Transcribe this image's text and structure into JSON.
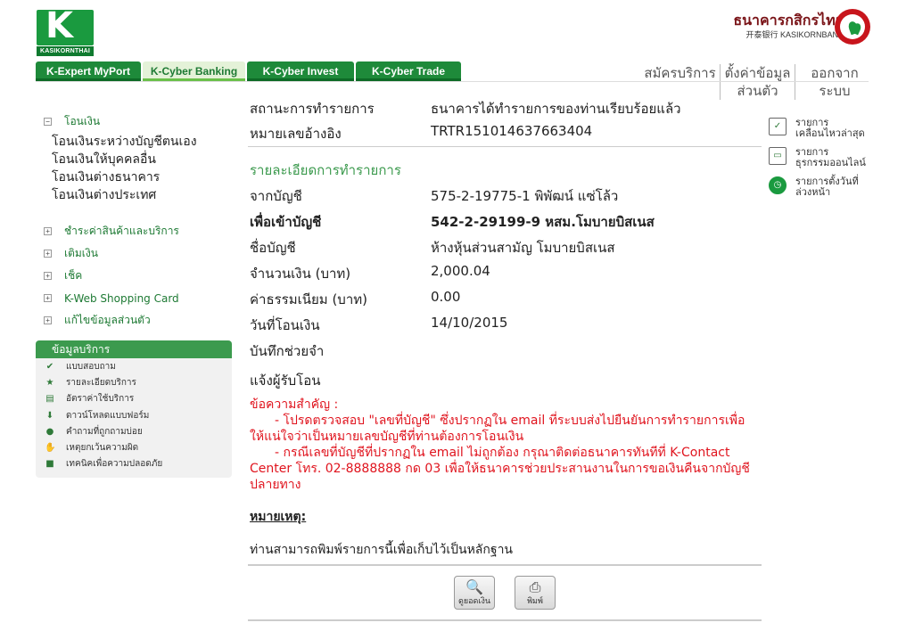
{
  "brand": {
    "logo_word": "KASIKORNTHAI",
    "logo_letter": "K",
    "bank_name_th": "ธนาคารกสิกรไทย",
    "bank_name_en": "开泰银行 KASIKORNBANK"
  },
  "main_tabs": [
    {
      "label": "K-Expert MyPort",
      "active": false
    },
    {
      "label": "K-Cyber Banking",
      "active": true
    },
    {
      "label": "K-Cyber Invest",
      "active": false
    },
    {
      "label": "K-Cyber Trade",
      "active": false
    }
  ],
  "top_links": {
    "register": "สมัครบริการ",
    "settings_line1": "ตั้งค่าข้อมูล",
    "settings_line2": "ส่วนตัว",
    "logout_line1": "ออกจาก",
    "logout_line2": "ระบบ"
  },
  "sidebar": {
    "transfer_group": "โอนเงิน",
    "transfer_items": [
      "โอนเงินระหว่างบัญชีตนเอง",
      "โอนเงินให้บุคคลอื่น",
      "โอนเงินต่างธนาคาร",
      "โอนเงินต่างประเทศ"
    ],
    "groups": [
      "ชำระค่าสินค้าและบริการ",
      "เติมเงิน",
      "เช็ค",
      "K-Web Shopping Card",
      "แก้ไขข้อมูลส่วนตัว"
    ],
    "service_box_title": "ข้อมูลบริการ",
    "service_items": [
      "แบบสอบถาม",
      "รายละเอียดบริการ",
      "อัตราค่าใช้บริการ",
      "ดาวน์โหลดแบบฟอร์ม",
      "คำถามที่ถูกถามบ่อย",
      "เหตุยกเว้นความผิด",
      "เทคนิคเพื่อความปลอดภัย"
    ]
  },
  "quick_links": [
    {
      "line1": "รายการ",
      "line2": "เคลื่อนไหวล่าสุด"
    },
    {
      "line1": "รายการ",
      "line2": "ธุรกรรมออนไลน์"
    },
    {
      "line1": "รายการตั้งวันที่",
      "line2": "ล่วงหน้า"
    }
  ],
  "transaction": {
    "status_label": "สถานะการทำรายการ",
    "status_value": "ธนาคารได้ทำรายการของท่านเรียบร้อยแล้ว",
    "ref_label": "หมายเลขอ้างอิง",
    "ref_value": "TRTR151014637663404",
    "section_title": "รายละเอียดการทำรายการ",
    "from_label": "จากบัญชี",
    "from_value": "575-2-19775-1 พิพัฒน์ แซ่โล้ว",
    "to_label": "เพื่อเข้าบัญชี",
    "to_value": "542-2-29199-9 หสม.โมบายบิสเนส",
    "name_label": "ชื่อบัญชี",
    "name_value": "ห้างหุ้นส่วนสามัญ โมบายบิสเนส",
    "amount_label": "จำนวนเงิน (บาท)",
    "amount_value": "2,000.04",
    "fee_label": "ค่าธรรมเนียม (บาท)",
    "fee_value": "0.00",
    "date_label": "วันที่โอนเงิน",
    "date_value": "14/10/2015",
    "memo_label": "บันทึกช่วยจำ",
    "notify_label": "แจ้งผู้รับโอน"
  },
  "notice": {
    "title": "ข้อความสำคัญ :",
    "line1": "- โปรดตรวจสอบ \"เลขที่บัญชี\" ซึ่งปรากฏใน email ที่ระบบส่งไปยืนยันการทำรายการเพื่อให้แน่ใจว่าเป็นหมายเลขบัญชีที่ท่านต้องการโอนเงิน",
    "line2": "- กรณีเลขที่บัญชีที่ปรากฏใน email ไม่ถูกต้อง กรุณาติดต่อธนาคารทันทีที่ K-Contact Center โทร. 02-8888888 กด 03 เพื่อให้ธนาคารช่วยประสานงานในการขอเงินคืนจากบัญชีปลายทาง"
  },
  "remark_title": "หมายเหตุ:",
  "print_hint": "ท่านสามารถพิมพ์รายการนี้เพื่อเก็บไว้เป็นหลักฐาน",
  "actions": {
    "check_balance": "ดูยอดเงิน",
    "print": "พิมพ์"
  },
  "colors": {
    "brand_green": "#1a9a3f",
    "notice_red": "#e0141e",
    "bank_maroon": "#7a1418"
  }
}
